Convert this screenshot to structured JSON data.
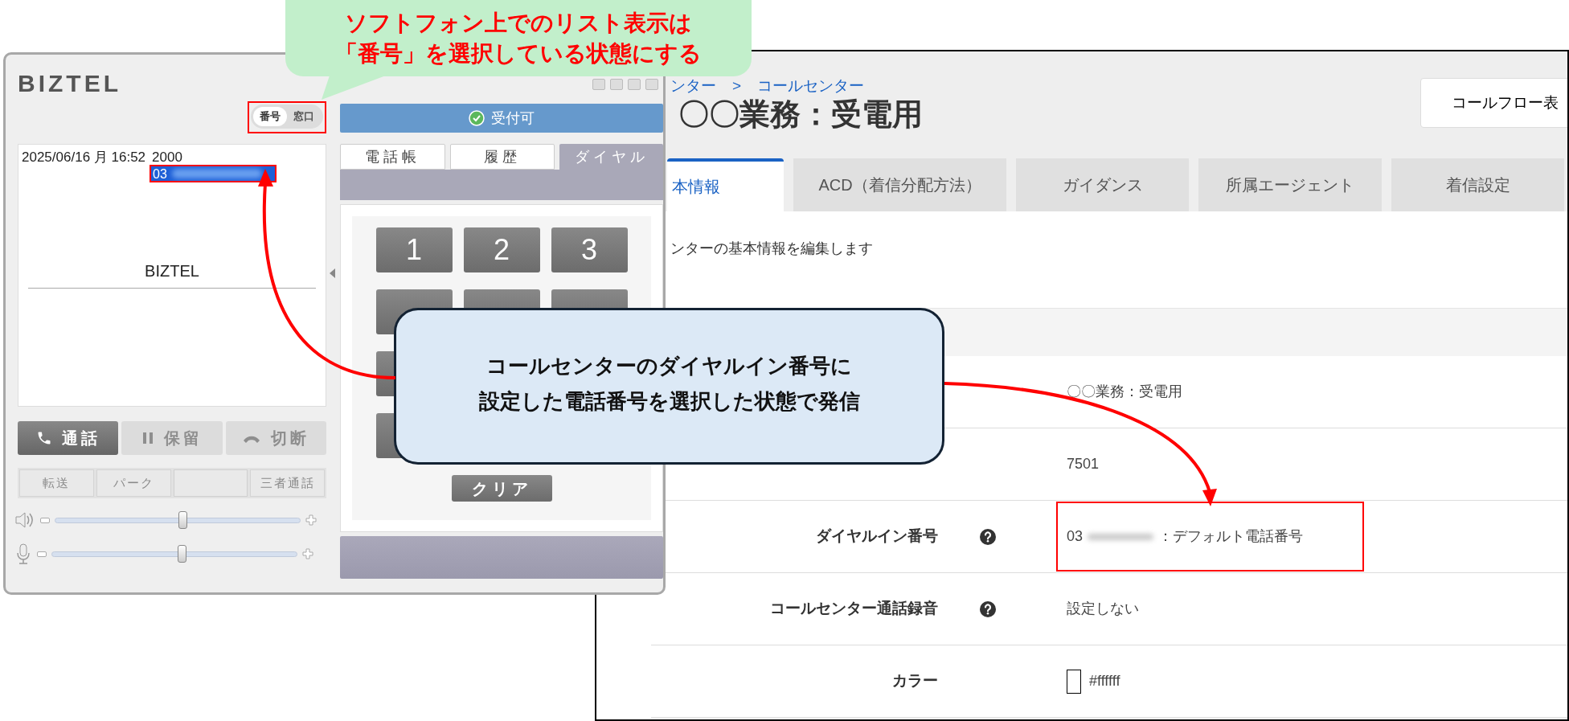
{
  "softphone": {
    "logo": "BIZTEL",
    "view_toggle": [
      {
        "label": "番号",
        "selected": true
      },
      {
        "label": "窓口",
        "selected": false
      }
    ],
    "call_log": {
      "datetime": "2025/06/16 月 16:52",
      "extension": "2000",
      "caller_number": "03"
    },
    "display_name": "BIZTEL",
    "call_buttons": [
      {
        "kind": "call",
        "label": "通話",
        "disabled": false
      },
      {
        "kind": "hold",
        "label": "保留",
        "disabled": true
      },
      {
        "kind": "hangup",
        "label": "切断",
        "disabled": true
      }
    ],
    "sub_buttons": [
      {
        "kind": "label",
        "label": "転送"
      },
      {
        "kind": "label",
        "label": "パーク"
      },
      {
        "kind": "blank"
      },
      {
        "kind": "label",
        "label": "三者通話"
      }
    ],
    "sliders": [
      {
        "kind": "speaker",
        "level": 0.52
      },
      {
        "kind": "mic",
        "level": 0.53
      }
    ],
    "status": "受付可",
    "tabs": [
      {
        "label": "電話帳",
        "selected": false
      },
      {
        "label": "履歴",
        "selected": false
      },
      {
        "label": "ダイヤル",
        "selected": true
      }
    ],
    "keypad": [
      "1",
      "2",
      "3"
    ],
    "clear_button": "クリア"
  },
  "admin_page": {
    "breadcrumb": [
      "ンター",
      "コールセンター"
    ],
    "breadcrumb_separator": ">",
    "title": "〇〇業務：受電用",
    "header_button": "コールフロー表",
    "tabs": [
      {
        "label": "本情報",
        "selected": true
      },
      {
        "label": "ACD（着信分配方法）",
        "selected": false
      },
      {
        "label": "ガイダンス",
        "selected": false
      },
      {
        "label": "所属エージェント",
        "selected": false
      },
      {
        "label": "着信設定",
        "selected": false
      }
    ],
    "description": "ンターの基本情報を編集します",
    "rows": [
      {
        "kind": "text",
        "value": "〇〇業務：受電用"
      },
      {
        "kind": "text",
        "value": "7501"
      },
      {
        "kind": "number",
        "label": "ダイヤルイン番号",
        "value_prefix": "03",
        "value_suffix": "：デフォルト電話番号",
        "help": true
      },
      {
        "kind": "text",
        "label": "コールセンター通話録音",
        "value": "設定しない",
        "help": true
      },
      {
        "kind": "color",
        "label": "カラー",
        "value": "#ffffff"
      }
    ]
  },
  "callouts": [
    {
      "kind": "green",
      "lines": [
        "ソフトフォン上でのリスト表示は",
        "「番号」を選択している状態にする"
      ]
    },
    {
      "kind": "blue",
      "lines": [
        "コールセンターのダイヤルイン番号に",
        "設定した電話番号を選択した状態で発信"
      ]
    }
  ]
}
